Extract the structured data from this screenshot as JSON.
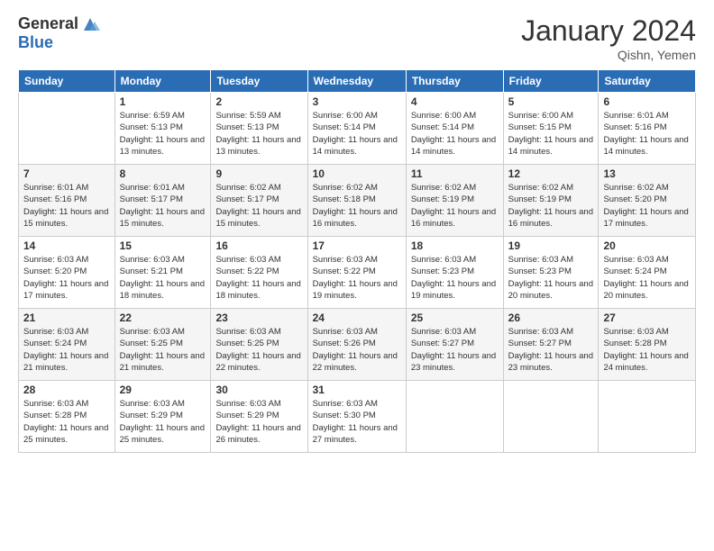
{
  "header": {
    "logo_general": "General",
    "logo_blue": "Blue",
    "title": "January 2024",
    "location": "Qishn, Yemen"
  },
  "columns": [
    "Sunday",
    "Monday",
    "Tuesday",
    "Wednesday",
    "Thursday",
    "Friday",
    "Saturday"
  ],
  "weeks": [
    [
      {
        "day": "",
        "sunrise": "",
        "sunset": "",
        "daylight": ""
      },
      {
        "day": "1",
        "sunrise": "6:59 AM",
        "sunset": "5:13 PM",
        "daylight": "11 hours and 13 minutes."
      },
      {
        "day": "2",
        "sunrise": "5:59 AM",
        "sunset": "5:13 PM",
        "daylight": "11 hours and 13 minutes."
      },
      {
        "day": "3",
        "sunrise": "6:00 AM",
        "sunset": "5:14 PM",
        "daylight": "11 hours and 14 minutes."
      },
      {
        "day": "4",
        "sunrise": "6:00 AM",
        "sunset": "5:14 PM",
        "daylight": "11 hours and 14 minutes."
      },
      {
        "day": "5",
        "sunrise": "6:00 AM",
        "sunset": "5:15 PM",
        "daylight": "11 hours and 14 minutes."
      },
      {
        "day": "6",
        "sunrise": "6:01 AM",
        "sunset": "5:16 PM",
        "daylight": "11 hours and 14 minutes."
      }
    ],
    [
      {
        "day": "7",
        "sunrise": "6:01 AM",
        "sunset": "5:16 PM",
        "daylight": "11 hours and 15 minutes."
      },
      {
        "day": "8",
        "sunrise": "6:01 AM",
        "sunset": "5:17 PM",
        "daylight": "11 hours and 15 minutes."
      },
      {
        "day": "9",
        "sunrise": "6:02 AM",
        "sunset": "5:17 PM",
        "daylight": "11 hours and 15 minutes."
      },
      {
        "day": "10",
        "sunrise": "6:02 AM",
        "sunset": "5:18 PM",
        "daylight": "11 hours and 16 minutes."
      },
      {
        "day": "11",
        "sunrise": "6:02 AM",
        "sunset": "5:19 PM",
        "daylight": "11 hours and 16 minutes."
      },
      {
        "day": "12",
        "sunrise": "6:02 AM",
        "sunset": "5:19 PM",
        "daylight": "11 hours and 16 minutes."
      },
      {
        "day": "13",
        "sunrise": "6:02 AM",
        "sunset": "5:20 PM",
        "daylight": "11 hours and 17 minutes."
      }
    ],
    [
      {
        "day": "14",
        "sunrise": "6:03 AM",
        "sunset": "5:20 PM",
        "daylight": "11 hours and 17 minutes."
      },
      {
        "day": "15",
        "sunrise": "6:03 AM",
        "sunset": "5:21 PM",
        "daylight": "11 hours and 18 minutes."
      },
      {
        "day": "16",
        "sunrise": "6:03 AM",
        "sunset": "5:22 PM",
        "daylight": "11 hours and 18 minutes."
      },
      {
        "day": "17",
        "sunrise": "6:03 AM",
        "sunset": "5:22 PM",
        "daylight": "11 hours and 19 minutes."
      },
      {
        "day": "18",
        "sunrise": "6:03 AM",
        "sunset": "5:23 PM",
        "daylight": "11 hours and 19 minutes."
      },
      {
        "day": "19",
        "sunrise": "6:03 AM",
        "sunset": "5:23 PM",
        "daylight": "11 hours and 20 minutes."
      },
      {
        "day": "20",
        "sunrise": "6:03 AM",
        "sunset": "5:24 PM",
        "daylight": "11 hours and 20 minutes."
      }
    ],
    [
      {
        "day": "21",
        "sunrise": "6:03 AM",
        "sunset": "5:24 PM",
        "daylight": "11 hours and 21 minutes."
      },
      {
        "day": "22",
        "sunrise": "6:03 AM",
        "sunset": "5:25 PM",
        "daylight": "11 hours and 21 minutes."
      },
      {
        "day": "23",
        "sunrise": "6:03 AM",
        "sunset": "5:25 PM",
        "daylight": "11 hours and 22 minutes."
      },
      {
        "day": "24",
        "sunrise": "6:03 AM",
        "sunset": "5:26 PM",
        "daylight": "11 hours and 22 minutes."
      },
      {
        "day": "25",
        "sunrise": "6:03 AM",
        "sunset": "5:27 PM",
        "daylight": "11 hours and 23 minutes."
      },
      {
        "day": "26",
        "sunrise": "6:03 AM",
        "sunset": "5:27 PM",
        "daylight": "11 hours and 23 minutes."
      },
      {
        "day": "27",
        "sunrise": "6:03 AM",
        "sunset": "5:28 PM",
        "daylight": "11 hours and 24 minutes."
      }
    ],
    [
      {
        "day": "28",
        "sunrise": "6:03 AM",
        "sunset": "5:28 PM",
        "daylight": "11 hours and 25 minutes."
      },
      {
        "day": "29",
        "sunrise": "6:03 AM",
        "sunset": "5:29 PM",
        "daylight": "11 hours and 25 minutes."
      },
      {
        "day": "30",
        "sunrise": "6:03 AM",
        "sunset": "5:29 PM",
        "daylight": "11 hours and 26 minutes."
      },
      {
        "day": "31",
        "sunrise": "6:03 AM",
        "sunset": "5:30 PM",
        "daylight": "11 hours and 27 minutes."
      },
      {
        "day": "",
        "sunrise": "",
        "sunset": "",
        "daylight": ""
      },
      {
        "day": "",
        "sunrise": "",
        "sunset": "",
        "daylight": ""
      },
      {
        "day": "",
        "sunrise": "",
        "sunset": "",
        "daylight": ""
      }
    ]
  ],
  "labels": {
    "sunrise_prefix": "Sunrise: ",
    "sunset_prefix": "Sunset: ",
    "daylight_prefix": "Daylight: "
  }
}
